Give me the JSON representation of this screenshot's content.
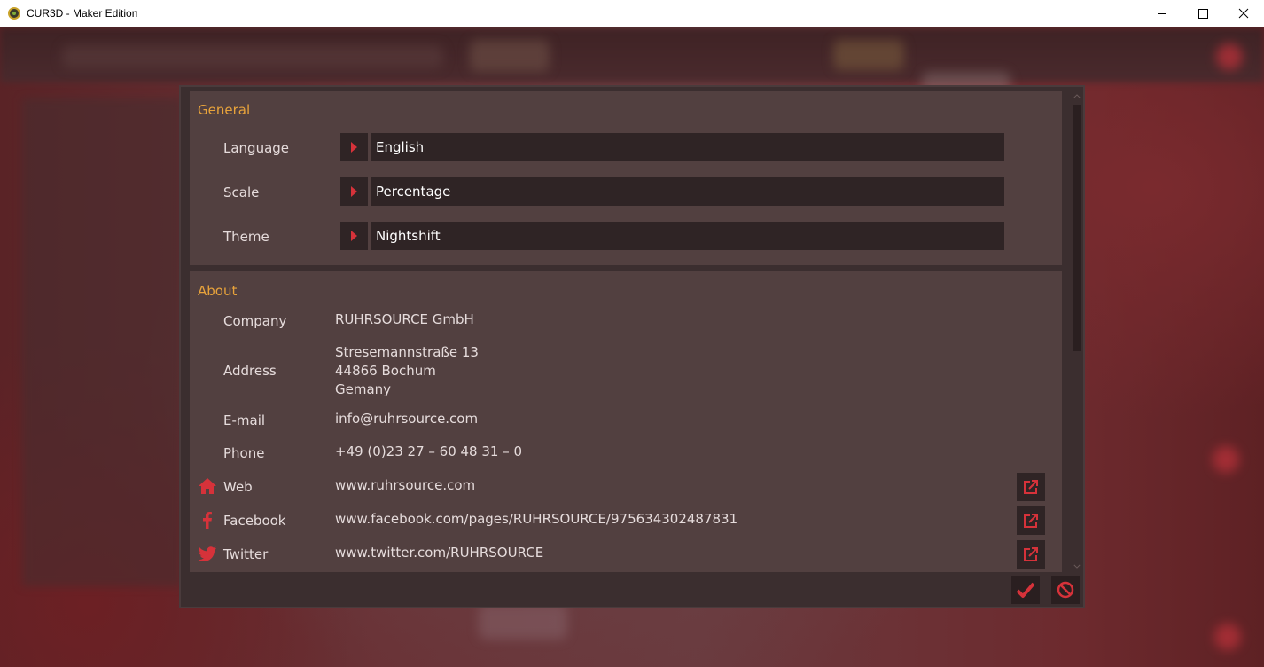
{
  "window": {
    "title": "CUR3D - Maker Edition"
  },
  "theme": {
    "accent": "#e8a33b",
    "icon_red": "#d6323a",
    "panel": "#524040",
    "field": "#2f2425"
  },
  "general": {
    "title": "General",
    "settings": [
      {
        "label": "Language",
        "value": "English"
      },
      {
        "label": "Scale",
        "value": "Percentage"
      },
      {
        "label": "Theme",
        "value": "Nightshift"
      }
    ]
  },
  "about": {
    "title": "About",
    "company": {
      "label": "Company",
      "value": "RUHRSOURCE GmbH"
    },
    "address": {
      "label": "Address",
      "lines": [
        "Stresemannstraße 13",
        "44866 Bochum",
        "Gemany"
      ]
    },
    "email": {
      "label": "E-mail",
      "value": "info@ruhrsource.com"
    },
    "phone": {
      "label": "Phone",
      "value": "+49 (0)23 27 – 60 48 31 – 0"
    },
    "web": {
      "label": "Web",
      "value": "www.ruhrsource.com",
      "icon": "home-icon"
    },
    "facebook": {
      "label": "Facebook",
      "value": "www.facebook.com/pages/RUHRSOURCE/975634302487831",
      "icon": "facebook-icon"
    },
    "twitter": {
      "label": "Twitter",
      "value": "www.twitter.com/RUHRSOURCE",
      "icon": "twitter-icon"
    }
  },
  "footer": {
    "ok_icon": "checkmark-icon",
    "cancel_icon": "prohibited-icon"
  }
}
